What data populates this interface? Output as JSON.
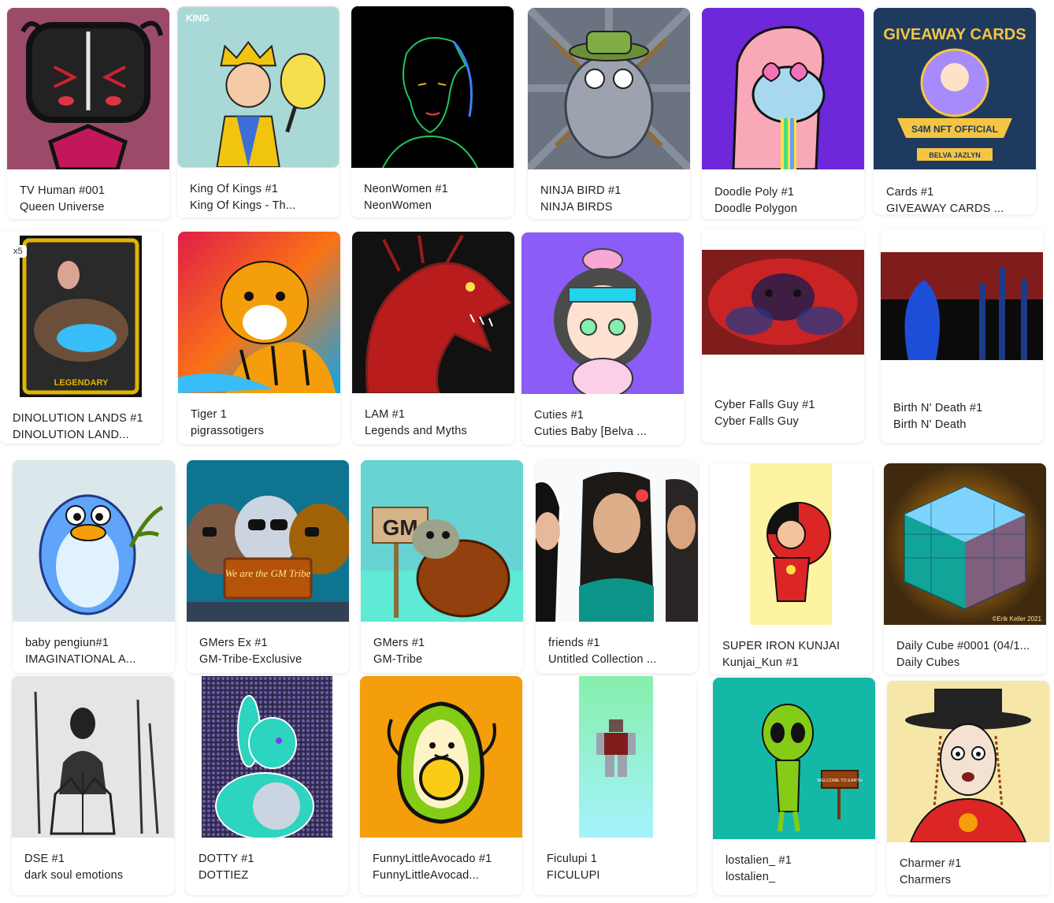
{
  "cards": [
    {
      "title": "TV Human #001",
      "collection": "Queen Universe"
    },
    {
      "title": "King Of Kings #1",
      "collection": "King Of Kings - Th...",
      "art_text": "KING"
    },
    {
      "title": "NeonWomen #1",
      "collection": "NeonWomen"
    },
    {
      "title": "NINJA BIRD #1",
      "collection": "NINJA BIRDS"
    },
    {
      "title": "Doodle Poly #1",
      "collection": "Doodle Polygon"
    },
    {
      "title": "Cards #1",
      "collection": "GIVEAWAY CARDS ...",
      "art_text": "GIVEAWAY CARDS",
      "art_text2": "S4M NFT OFFICIAL",
      "art_text3": "BELVA JAZLYN"
    },
    {
      "title": "DINOLUTION LANDS #1",
      "collection": "DINOLUTION LAND...",
      "badge": "x5",
      "art_text": "LEGENDARY"
    },
    {
      "title": "Tiger 1",
      "collection": "pigrassotigers"
    },
    {
      "title": "LAM #1",
      "collection": "Legends and Myths"
    },
    {
      "title": "Cuties #1",
      "collection": "Cuties Baby [Belva ..."
    },
    {
      "title": "Cyber Falls Guy #1",
      "collection": "Cyber Falls Guy"
    },
    {
      "title": "Birth N' Death #1",
      "collection": "Birth N' Death"
    },
    {
      "title": "baby pengiun#1",
      "collection": "IMAGINATIONAL A..."
    },
    {
      "title": "GMers Ex #1",
      "collection": "GM-Tribe-Exclusive",
      "art_text": "We are the GM Tribe"
    },
    {
      "title": "GMers #1",
      "collection": "GM-Tribe",
      "art_text": "GM"
    },
    {
      "title": "friends #1",
      "collection": "Untitled Collection ..."
    },
    {
      "title": "SUPER IRON KUNJAI",
      "collection": "Kunjai_Kun #1"
    },
    {
      "title": "Daily Cube #0001 (04/1...",
      "collection": "Daily Cubes",
      "art_text": "©Erik Keller 2021"
    },
    {
      "title": "DSE #1",
      "collection": "dark soul emotions"
    },
    {
      "title": "DOTTY #1",
      "collection": "DOTTIEZ"
    },
    {
      "title": "FunnyLittleAvocado #1",
      "collection": "FunnyLittleAvocad..."
    },
    {
      "title": "Ficulupi 1",
      "collection": "FICULUPI"
    },
    {
      "title": "lostalien_ #1",
      "collection": "lostalien_",
      "art_text": "WELCOME TO EARTH"
    },
    {
      "title": "Charmer #1",
      "collection": "Charmers"
    }
  ]
}
